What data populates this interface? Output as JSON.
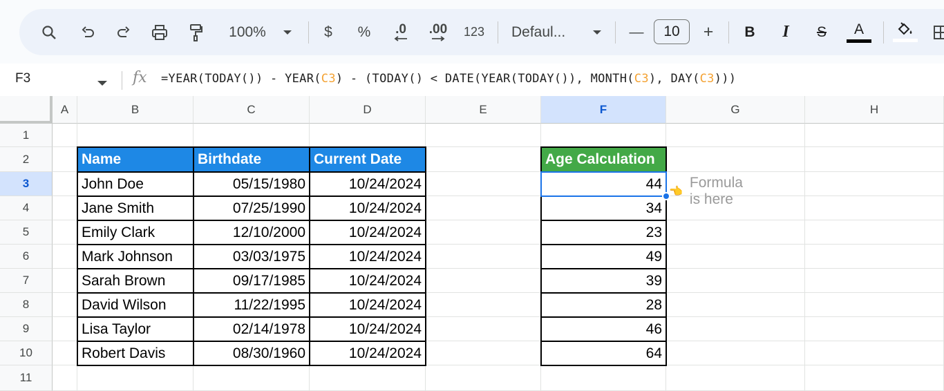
{
  "toolbar": {
    "zoom": "100%",
    "currency_label": "$",
    "percent_label": "%",
    "decrease_decimal_label": ".0",
    "increase_decimal_label": ".00",
    "number_format_label": "123",
    "font_name": "Defaul...",
    "font_size": "10",
    "minus_label": "—",
    "plus_label": "+",
    "bold_label": "B",
    "italic_label": "I",
    "strike_label": "S",
    "text_color_label": "A"
  },
  "formula_bar": {
    "cell_ref": "F3",
    "fx_label": "fx",
    "formula_parts": [
      "=YEAR(TODAY()) - YEAR(",
      "C3",
      ") - (TODAY() < DATE(YEAR(TODAY()), MONTH(",
      "C3",
      "), DAY(",
      "C3",
      ")))"
    ]
  },
  "columns": [
    "A",
    "B",
    "C",
    "D",
    "E",
    "F",
    "G",
    "H"
  ],
  "selected_column": "F",
  "rows": [
    "1",
    "2",
    "3",
    "4",
    "5",
    "6",
    "7",
    "8",
    "9",
    "10",
    "11"
  ],
  "selected_row": "3",
  "table": {
    "headers": [
      "Name",
      "Birthdate",
      "Current Date"
    ],
    "rows": [
      [
        "John Doe",
        "05/15/1980",
        "10/24/2024"
      ],
      [
        "Jane Smith",
        "07/25/1990",
        "10/24/2024"
      ],
      [
        "Emily Clark",
        "12/10/2000",
        "10/24/2024"
      ],
      [
        "Mark Johnson",
        "03/03/1975",
        "10/24/2024"
      ],
      [
        "Sarah Brown",
        "09/17/1985",
        "10/24/2024"
      ],
      [
        "David Wilson",
        "11/22/1995",
        "10/24/2024"
      ],
      [
        "Lisa Taylor",
        "02/14/1978",
        "10/24/2024"
      ],
      [
        "Robert Davis",
        "08/30/1960",
        "10/24/2024"
      ]
    ]
  },
  "age_table": {
    "header": "Age Calculation",
    "values": [
      "44",
      "34",
      "23",
      "49",
      "39",
      "28",
      "46",
      "64"
    ]
  },
  "annotation": {
    "pointer": "👈",
    "text": "Formula is here"
  },
  "colors": {
    "name_header": "#1e88e5",
    "age_header": "#43a947",
    "selection": "#1a73e8",
    "cell_ref_highlight": "#f4a233"
  }
}
